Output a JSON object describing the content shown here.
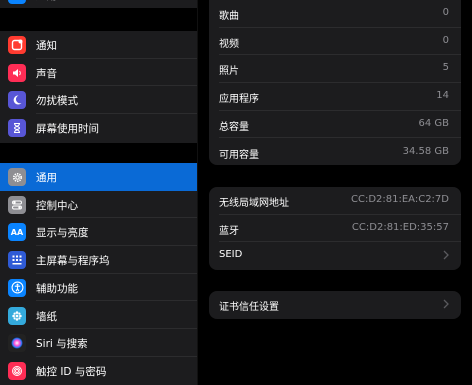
{
  "sidebar": {
    "top_partial_label": "通用",
    "items": [
      {
        "label": "通知",
        "icon": "notifications-icon",
        "color": "#ff3b30"
      },
      {
        "label": "声音",
        "icon": "sounds-icon",
        "color": "#ff2d55"
      },
      {
        "label": "勿扰模式",
        "icon": "do-not-disturb-icon",
        "color": "#5856d6"
      },
      {
        "label": "屏幕使用时间",
        "icon": "screen-time-icon",
        "color": "#5856d6"
      },
      {
        "label": "通用",
        "icon": "general-gear-icon",
        "color": "#8e8e93",
        "selected": true
      },
      {
        "label": "控制中心",
        "icon": "control-center-icon",
        "color": "#8e8e93"
      },
      {
        "label": "显示与亮度",
        "icon": "display-brightness-icon",
        "color": "#0a84ff"
      },
      {
        "label": "主屏幕与程序坞",
        "icon": "home-screen-dock-icon",
        "color": "#2f5bd6"
      },
      {
        "label": "辅助功能",
        "icon": "accessibility-icon",
        "color": "#0a84ff"
      },
      {
        "label": "墙纸",
        "icon": "wallpaper-icon",
        "color": "#34aadc"
      },
      {
        "label": "Siri 与搜索",
        "icon": "siri-icon",
        "color": "#222222"
      },
      {
        "label": "触控 ID 与密码",
        "icon": "touch-id-icon",
        "color": "#ff2d55"
      }
    ]
  },
  "about": {
    "stats": [
      {
        "label": "歌曲",
        "value": "0"
      },
      {
        "label": "视频",
        "value": "0"
      },
      {
        "label": "照片",
        "value": "5"
      },
      {
        "label": "应用程序",
        "value": "14"
      },
      {
        "label": "总容量",
        "value": "64 GB"
      },
      {
        "label": "可用容量",
        "value": "34.58 GB"
      }
    ],
    "network": [
      {
        "label": "无线局域网地址",
        "value": "CC:D2:81:EA:C2:7D"
      },
      {
        "label": "蓝牙",
        "value": "CC:D2:81:ED:35:57"
      },
      {
        "label": "SEID",
        "value": ""
      }
    ],
    "certificate": {
      "label": "证书信任设置"
    }
  }
}
